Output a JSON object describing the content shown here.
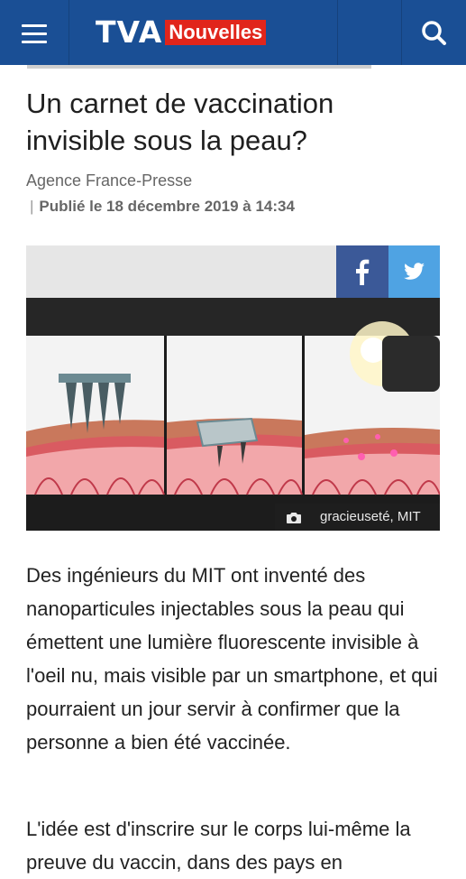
{
  "header": {
    "logo_primary": "TVA",
    "logo_secondary": "Nouvelles",
    "brand_color": "#1a4f95",
    "accent_color": "#e1251b",
    "icons": {
      "menu": "menu-icon",
      "search": "search-icon"
    }
  },
  "article": {
    "title": "Un carnet de vaccination invisible sous la peau?",
    "agency": "Agence France-Presse",
    "published": "Publié le 18 décembre 2019 à 14:34",
    "share": {
      "facebook": "f",
      "facebook_color": "#3b5998",
      "twitter_color": "#4fa3e3"
    },
    "image_credit": "gracieuseté, MIT",
    "paragraph1": "Des ingénieurs du MIT ont inventé des nanoparticules injectables sous la peau qui émettent une lumière fluorescente invisible à l'oeil nu, mais visible par un smartphone, et qui pourraient un jour servir à confirmer que la personne a bien été vaccinée.",
    "paragraph2": "L'idée est d'inscrire sur le corps lui-même la preuve du vaccin, dans des pays en"
  }
}
